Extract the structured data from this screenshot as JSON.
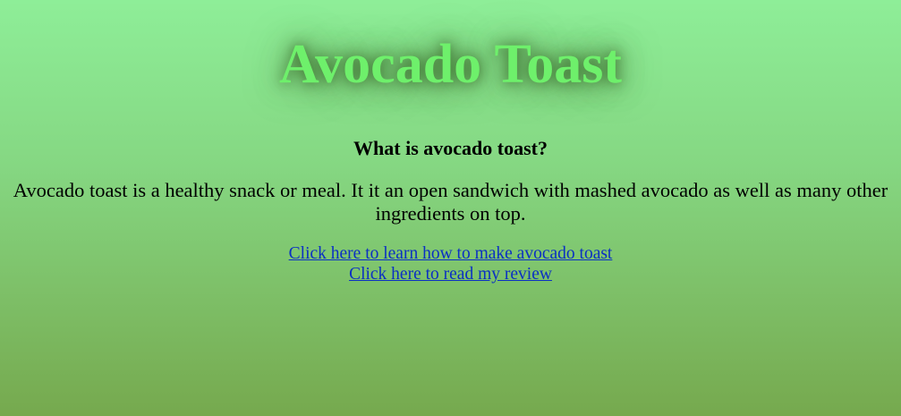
{
  "header": {
    "title": "Avocado Toast"
  },
  "main": {
    "subtitle": "What is avocado toast?",
    "description": "Avocado toast is a healthy snack or meal. It it an open sandwich with mashed avocado as well as many other ingredients on top.",
    "links": [
      {
        "label": "Click here to learn how to make avocado toast"
      },
      {
        "label": "Click here to read my review"
      }
    ]
  },
  "colors": {
    "title": "#6ef06b",
    "link": "#0a2fc4",
    "background_top": "#8eee98",
    "background_bottom": "#76a94e"
  }
}
